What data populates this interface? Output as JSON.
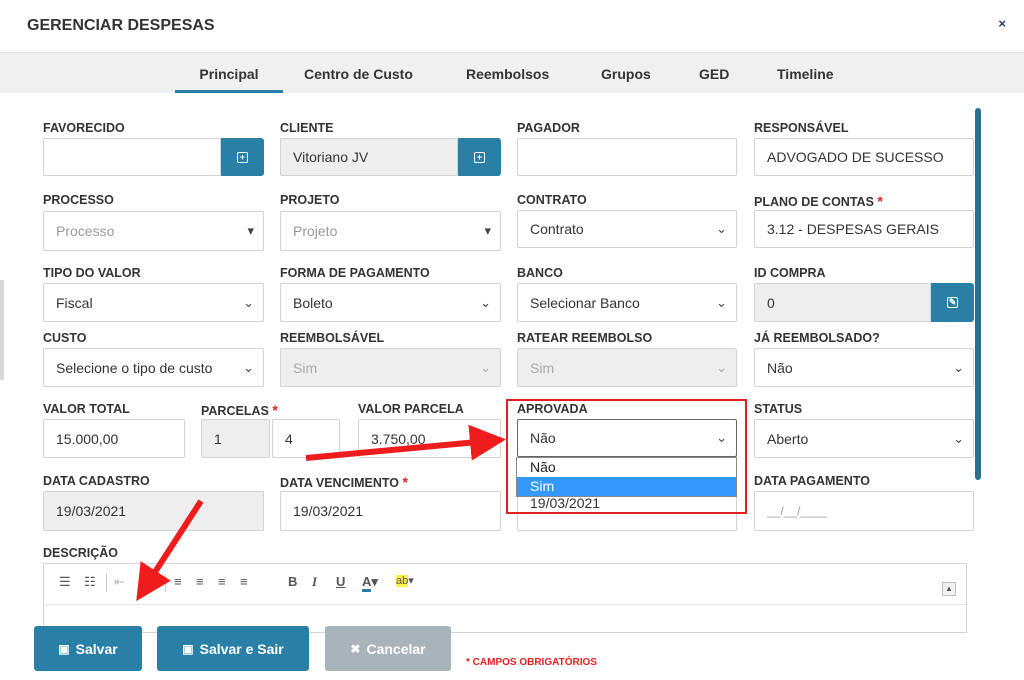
{
  "header": {
    "title": "GERENCIAR DESPESAS",
    "close": "×"
  },
  "tabs": [
    {
      "label": "Principal"
    },
    {
      "label": "Centro de Custo"
    },
    {
      "label": "Reembolsos"
    },
    {
      "label": "Grupos"
    },
    {
      "label": "GED"
    },
    {
      "label": "Timeline"
    }
  ],
  "form": {
    "favorecido": {
      "label": "FAVORECIDO",
      "value": ""
    },
    "cliente": {
      "label": "CLIENTE",
      "value": "Vitoriano JV"
    },
    "pagador": {
      "label": "PAGADOR",
      "value": ""
    },
    "responsavel": {
      "label": "RESPONSÁVEL",
      "value": "ADVOGADO DE SUCESSO"
    },
    "processo": {
      "label": "PROCESSO",
      "placeholder": "Processo"
    },
    "projeto": {
      "label": "PROJETO",
      "placeholder": "Projeto"
    },
    "contrato": {
      "label": "CONTRATO",
      "value": "Contrato"
    },
    "plano_contas": {
      "label": "PLANO DE CONTAS",
      "required": "*",
      "value": "3.12 - DESPESAS GERAIS"
    },
    "tipo_valor": {
      "label": "TIPO DO VALOR",
      "value": "Fiscal"
    },
    "forma_pagamento": {
      "label": "FORMA DE PAGAMENTO",
      "value": "Boleto"
    },
    "banco": {
      "label": "BANCO",
      "value": "Selecionar Banco"
    },
    "id_compra": {
      "label": "ID COMPRA",
      "value": "0"
    },
    "custo": {
      "label": "CUSTO",
      "value": "Selecione o tipo de custo"
    },
    "reembolsavel": {
      "label": "REEMBOLSÁVEL",
      "value": "Sim"
    },
    "ratear_reembolso": {
      "label": "RATEAR REEMBOLSO",
      "value": "Sim"
    },
    "ja_reembolsado": {
      "label": "JÁ REEMBOLSADO?",
      "value": "Não"
    },
    "valor_total": {
      "label": "VALOR TOTAL",
      "value": "15.000,00"
    },
    "parcelas": {
      "label": "PARCELAS",
      "required": "*",
      "value_a": "1",
      "value_b": "4"
    },
    "valor_parcela": {
      "label": "VALOR PARCELA",
      "value": "3.750,00"
    },
    "aprovada": {
      "label": "APROVADA",
      "value": "Não",
      "options": [
        "Não",
        "Sim"
      ],
      "highlighted": "Sim"
    },
    "status": {
      "label": "STATUS",
      "value": "Aberto"
    },
    "data_cadastro": {
      "label": "DATA CADASTRO",
      "value": "19/03/2021"
    },
    "data_vencimento": {
      "label": "DATA VENCIMENTO",
      "required": "*",
      "value": "19/03/2021"
    },
    "data_partial": {
      "value": "19/03/2021"
    },
    "data_pagamento": {
      "label": "DATA PAGAMENTO",
      "placeholder": "__/__/____"
    },
    "descricao": {
      "label": "DESCRIÇÃO"
    }
  },
  "footer": {
    "save": "Salvar",
    "save_exit": "Salvar e Sair",
    "cancel": "Cancelar",
    "required_note": "* CAMPOS OBRIGATÓRIOS"
  },
  "colors": {
    "accent": "#2a7fa6",
    "highlight": "#e02020",
    "selected": "#3399ff"
  }
}
